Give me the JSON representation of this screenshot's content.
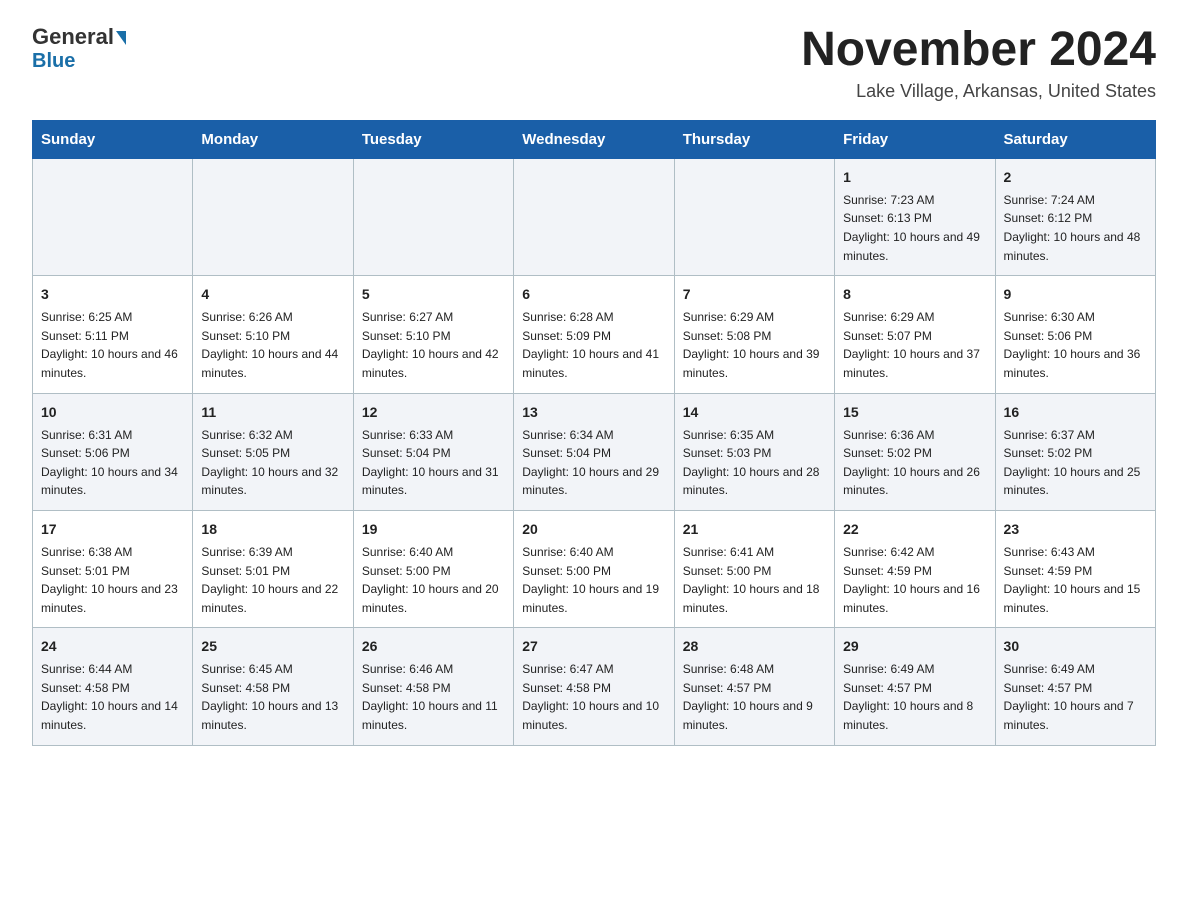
{
  "header": {
    "logo_general": "General",
    "logo_blue": "Blue",
    "month_title": "November 2024",
    "location": "Lake Village, Arkansas, United States"
  },
  "days_of_week": [
    "Sunday",
    "Monday",
    "Tuesday",
    "Wednesday",
    "Thursday",
    "Friday",
    "Saturday"
  ],
  "weeks": [
    [
      {
        "day": "",
        "sunrise": "",
        "sunset": "",
        "daylight": ""
      },
      {
        "day": "",
        "sunrise": "",
        "sunset": "",
        "daylight": ""
      },
      {
        "day": "",
        "sunrise": "",
        "sunset": "",
        "daylight": ""
      },
      {
        "day": "",
        "sunrise": "",
        "sunset": "",
        "daylight": ""
      },
      {
        "day": "",
        "sunrise": "",
        "sunset": "",
        "daylight": ""
      },
      {
        "day": "1",
        "sunrise": "Sunrise: 7:23 AM",
        "sunset": "Sunset: 6:13 PM",
        "daylight": "Daylight: 10 hours and 49 minutes."
      },
      {
        "day": "2",
        "sunrise": "Sunrise: 7:24 AM",
        "sunset": "Sunset: 6:12 PM",
        "daylight": "Daylight: 10 hours and 48 minutes."
      }
    ],
    [
      {
        "day": "3",
        "sunrise": "Sunrise: 6:25 AM",
        "sunset": "Sunset: 5:11 PM",
        "daylight": "Daylight: 10 hours and 46 minutes."
      },
      {
        "day": "4",
        "sunrise": "Sunrise: 6:26 AM",
        "sunset": "Sunset: 5:10 PM",
        "daylight": "Daylight: 10 hours and 44 minutes."
      },
      {
        "day": "5",
        "sunrise": "Sunrise: 6:27 AM",
        "sunset": "Sunset: 5:10 PM",
        "daylight": "Daylight: 10 hours and 42 minutes."
      },
      {
        "day": "6",
        "sunrise": "Sunrise: 6:28 AM",
        "sunset": "Sunset: 5:09 PM",
        "daylight": "Daylight: 10 hours and 41 minutes."
      },
      {
        "day": "7",
        "sunrise": "Sunrise: 6:29 AM",
        "sunset": "Sunset: 5:08 PM",
        "daylight": "Daylight: 10 hours and 39 minutes."
      },
      {
        "day": "8",
        "sunrise": "Sunrise: 6:29 AM",
        "sunset": "Sunset: 5:07 PM",
        "daylight": "Daylight: 10 hours and 37 minutes."
      },
      {
        "day": "9",
        "sunrise": "Sunrise: 6:30 AM",
        "sunset": "Sunset: 5:06 PM",
        "daylight": "Daylight: 10 hours and 36 minutes."
      }
    ],
    [
      {
        "day": "10",
        "sunrise": "Sunrise: 6:31 AM",
        "sunset": "Sunset: 5:06 PM",
        "daylight": "Daylight: 10 hours and 34 minutes."
      },
      {
        "day": "11",
        "sunrise": "Sunrise: 6:32 AM",
        "sunset": "Sunset: 5:05 PM",
        "daylight": "Daylight: 10 hours and 32 minutes."
      },
      {
        "day": "12",
        "sunrise": "Sunrise: 6:33 AM",
        "sunset": "Sunset: 5:04 PM",
        "daylight": "Daylight: 10 hours and 31 minutes."
      },
      {
        "day": "13",
        "sunrise": "Sunrise: 6:34 AM",
        "sunset": "Sunset: 5:04 PM",
        "daylight": "Daylight: 10 hours and 29 minutes."
      },
      {
        "day": "14",
        "sunrise": "Sunrise: 6:35 AM",
        "sunset": "Sunset: 5:03 PM",
        "daylight": "Daylight: 10 hours and 28 minutes."
      },
      {
        "day": "15",
        "sunrise": "Sunrise: 6:36 AM",
        "sunset": "Sunset: 5:02 PM",
        "daylight": "Daylight: 10 hours and 26 minutes."
      },
      {
        "day": "16",
        "sunrise": "Sunrise: 6:37 AM",
        "sunset": "Sunset: 5:02 PM",
        "daylight": "Daylight: 10 hours and 25 minutes."
      }
    ],
    [
      {
        "day": "17",
        "sunrise": "Sunrise: 6:38 AM",
        "sunset": "Sunset: 5:01 PM",
        "daylight": "Daylight: 10 hours and 23 minutes."
      },
      {
        "day": "18",
        "sunrise": "Sunrise: 6:39 AM",
        "sunset": "Sunset: 5:01 PM",
        "daylight": "Daylight: 10 hours and 22 minutes."
      },
      {
        "day": "19",
        "sunrise": "Sunrise: 6:40 AM",
        "sunset": "Sunset: 5:00 PM",
        "daylight": "Daylight: 10 hours and 20 minutes."
      },
      {
        "day": "20",
        "sunrise": "Sunrise: 6:40 AM",
        "sunset": "Sunset: 5:00 PM",
        "daylight": "Daylight: 10 hours and 19 minutes."
      },
      {
        "day": "21",
        "sunrise": "Sunrise: 6:41 AM",
        "sunset": "Sunset: 5:00 PM",
        "daylight": "Daylight: 10 hours and 18 minutes."
      },
      {
        "day": "22",
        "sunrise": "Sunrise: 6:42 AM",
        "sunset": "Sunset: 4:59 PM",
        "daylight": "Daylight: 10 hours and 16 minutes."
      },
      {
        "day": "23",
        "sunrise": "Sunrise: 6:43 AM",
        "sunset": "Sunset: 4:59 PM",
        "daylight": "Daylight: 10 hours and 15 minutes."
      }
    ],
    [
      {
        "day": "24",
        "sunrise": "Sunrise: 6:44 AM",
        "sunset": "Sunset: 4:58 PM",
        "daylight": "Daylight: 10 hours and 14 minutes."
      },
      {
        "day": "25",
        "sunrise": "Sunrise: 6:45 AM",
        "sunset": "Sunset: 4:58 PM",
        "daylight": "Daylight: 10 hours and 13 minutes."
      },
      {
        "day": "26",
        "sunrise": "Sunrise: 6:46 AM",
        "sunset": "Sunset: 4:58 PM",
        "daylight": "Daylight: 10 hours and 11 minutes."
      },
      {
        "day": "27",
        "sunrise": "Sunrise: 6:47 AM",
        "sunset": "Sunset: 4:58 PM",
        "daylight": "Daylight: 10 hours and 10 minutes."
      },
      {
        "day": "28",
        "sunrise": "Sunrise: 6:48 AM",
        "sunset": "Sunset: 4:57 PM",
        "daylight": "Daylight: 10 hours and 9 minutes."
      },
      {
        "day": "29",
        "sunrise": "Sunrise: 6:49 AM",
        "sunset": "Sunset: 4:57 PM",
        "daylight": "Daylight: 10 hours and 8 minutes."
      },
      {
        "day": "30",
        "sunrise": "Sunrise: 6:49 AM",
        "sunset": "Sunset: 4:57 PM",
        "daylight": "Daylight: 10 hours and 7 minutes."
      }
    ]
  ]
}
